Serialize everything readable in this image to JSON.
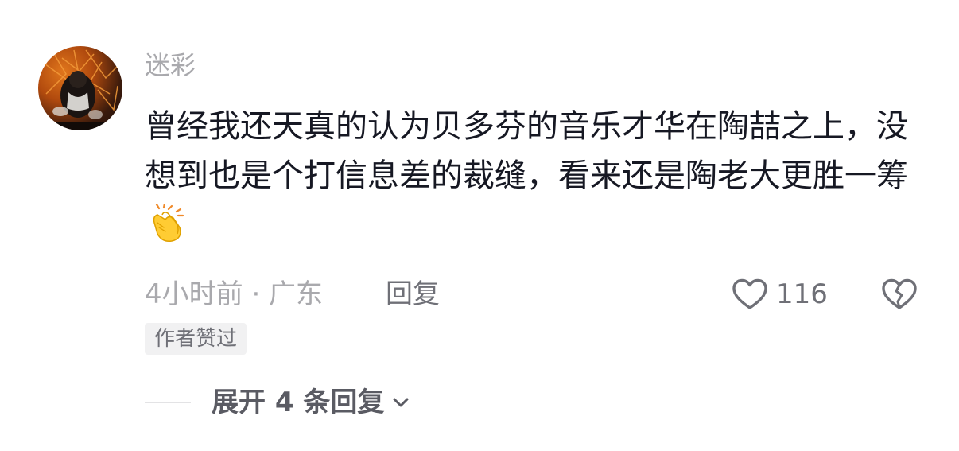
{
  "comment": {
    "username": "迷彩",
    "text": "曾经我还天真的认为贝多芬的音乐才华在陶喆之上，没想到也是个打信息差的裁缝，看来还是陶老大更胜一筹",
    "emoji": "clapping-hands-emoji",
    "time_location": "4小时前 · 广东",
    "reply_label": "回复",
    "like_count": "116",
    "author_badge": "作者赞过",
    "expand_replies_label": "展开 4 条回复"
  },
  "icons": {
    "like": "heart-outline-icon",
    "dislike": "broken-heart-icon",
    "expand": "chevron-down-icon"
  },
  "colors": {
    "text_primary": "#161823",
    "text_secondary": "#a9a9ad",
    "action_gray": "#6f7077",
    "badge_bg": "#f1f1f2"
  }
}
